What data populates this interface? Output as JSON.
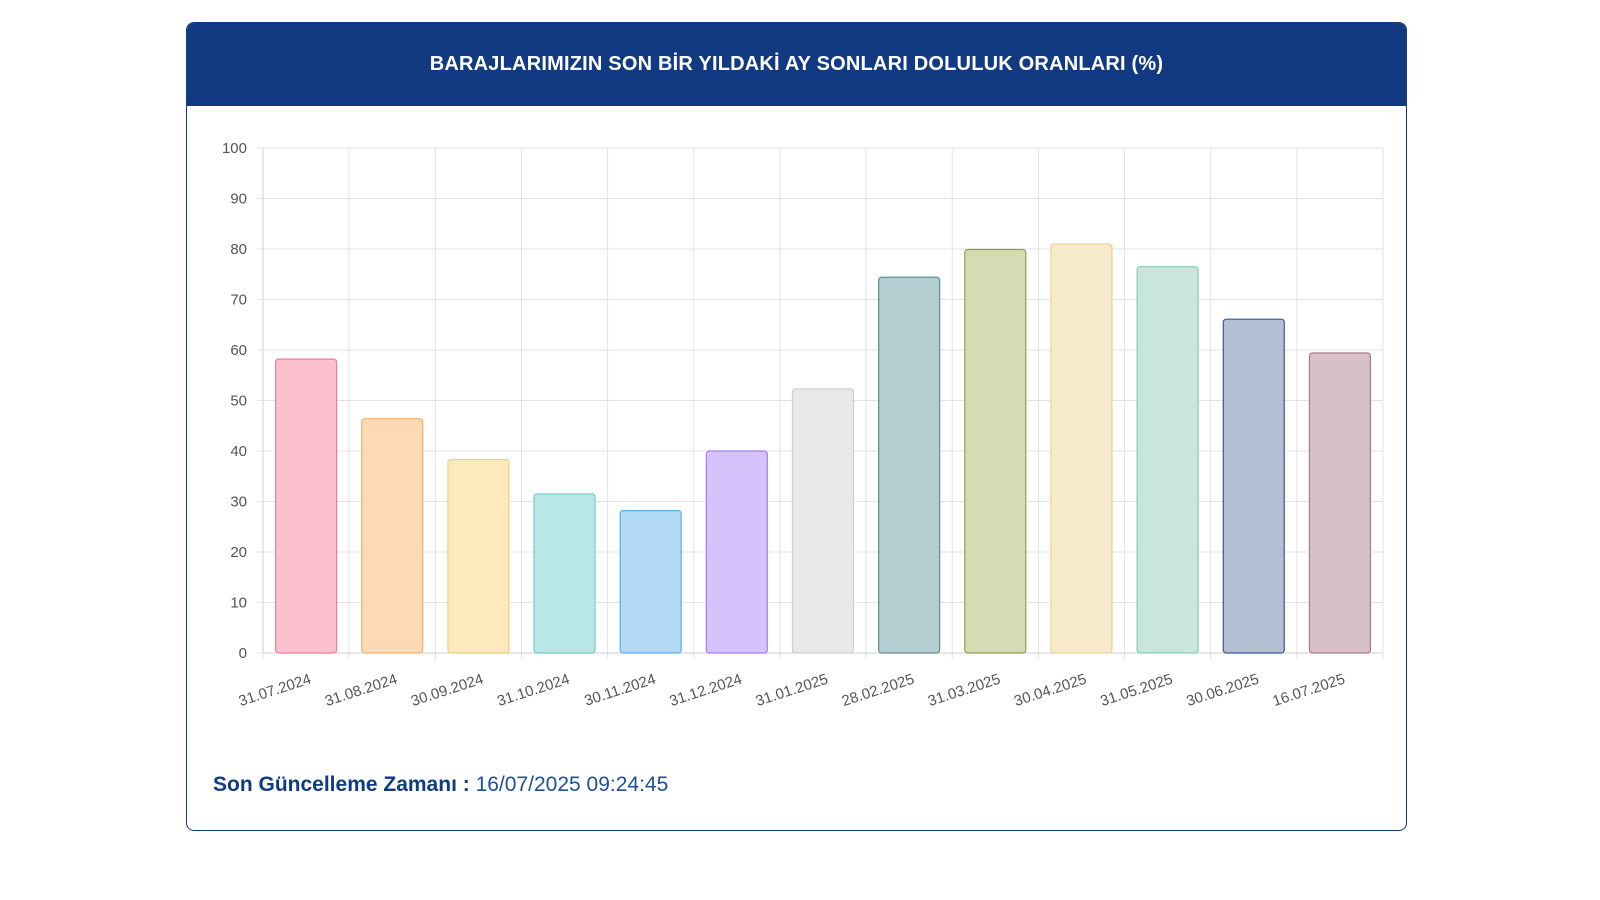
{
  "header": {
    "title": "BARAJLARIMIZIN SON BİR YILDAKİ AY SONLARI DOLULUK ORANLARI (%)"
  },
  "footer": {
    "label": "Son Güncelleme Zamanı :",
    "value": "16/07/2025 09:24:45"
  },
  "colors": {
    "header_bg": "#113a82",
    "border": "#0f3b83"
  },
  "chart_data": {
    "type": "bar",
    "title": "BARAJLARIMIZIN SON BİR YILDAKİ AY SONLARI DOLULUK ORANLARI (%)",
    "categories": [
      "31.07.2024",
      "31.08.2024",
      "30.09.2024",
      "31.10.2024",
      "30.11.2024",
      "31.12.2024",
      "31.01.2025",
      "28.02.2025",
      "31.03.2025",
      "30.04.2025",
      "31.05.2025",
      "30.06.2025",
      "16.07.2025"
    ],
    "values": [
      58.2,
      46.4,
      38.3,
      31.5,
      28.2,
      40.0,
      52.3,
      74.4,
      79.9,
      81.0,
      76.5,
      66.1,
      59.4
    ],
    "ylim": [
      0,
      100
    ],
    "yticks": [
      0,
      10,
      20,
      30,
      40,
      50,
      60,
      70,
      80,
      90,
      100
    ],
    "grid": true,
    "bar_fills": [
      "#fbc0cd",
      "#fdd9b5",
      "#fde9bb",
      "#b9e6e6",
      "#b2daf7",
      "#d6c3fb",
      "#e8e9eb",
      "#b3cdd1",
      "#d5dcb3",
      "#f7eacb",
      "#c8e6de",
      "#b3bfd2",
      "#d8c0c8"
    ],
    "bar_strokes": [
      "#f07b98",
      "#f4b06e",
      "#f2cf77",
      "#6fcdcc",
      "#5aaee6",
      "#a97bf0",
      "#cbcdd0",
      "#5e8f97",
      "#8ea04a",
      "#ecd28f",
      "#88cdb8",
      "#3b5b8e",
      "#a97a8a"
    ]
  }
}
